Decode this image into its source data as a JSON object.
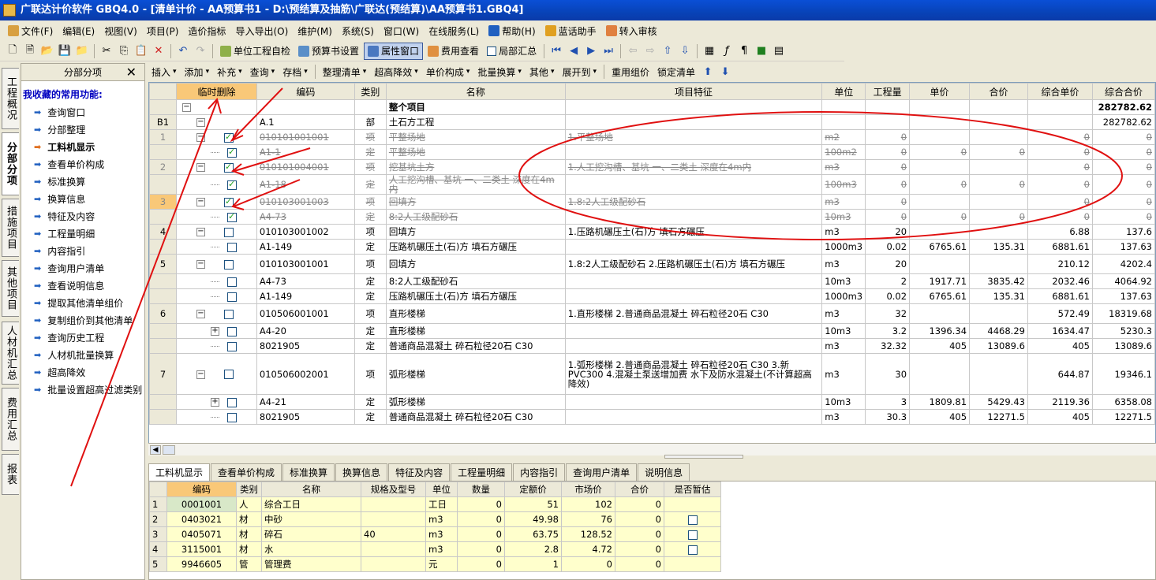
{
  "window": {
    "title": "广联达计价软件 GBQ4.0 - [清单计价 - AA预算书1 - D:\\预结算及抽筋\\广联达(预结算)\\AA预算书1.GBQ4]"
  },
  "menu": [
    "文件(F)",
    "编辑(E)",
    "视图(V)",
    "项目(P)",
    "造价指标",
    "导入导出(O)",
    "维护(M)",
    "系统(S)",
    "窗口(W)",
    "在线服务(L)",
    "帮助(H)",
    "蓝话助手",
    "转入审核"
  ],
  "toolbar1": {
    "self_check": "单位工程自检",
    "budget_settings": "预算书设置",
    "property_window": "属性窗口",
    "fee_view": "费用查看",
    "partial_summary": "局部汇总"
  },
  "toolbar2": [
    "插入",
    "添加",
    "补充",
    "查询",
    "存档",
    "整理清单",
    "超高降效",
    "单价构成",
    "批量换算",
    "其他",
    "展开到",
    "重用组价",
    "锁定清单"
  ],
  "left_tabs": [
    "工程概况",
    "分部分项",
    "措施项目",
    "其他项目",
    "人材机汇总",
    "费用汇总",
    "报表"
  ],
  "left_panel": {
    "title": "分部分项",
    "fav_title": "我收藏的常用功能:",
    "items": [
      "查询窗口",
      "分部整理",
      "工料机显示",
      "查看单价构成",
      "标准换算",
      "换算信息",
      "特征及内容",
      "工程量明细",
      "内容指引",
      "查询用户清单",
      "查看说明信息",
      "提取其他清单组价",
      "复制组价到其他清单",
      "查询历史工程",
      "人材机批量换算",
      "超高降效",
      "批量设置超高过滤类别"
    ]
  },
  "grid": {
    "headers": [
      "",
      "临时删除",
      "编码",
      "类别",
      "名称",
      "项目特征",
      "单位",
      "工程量",
      "单价",
      "合价",
      "综合单价",
      "综合合价"
    ],
    "rows": [
      {
        "rn": "",
        "pm": "-",
        "lvl": 0,
        "chk": "",
        "code": "",
        "type": "",
        "name": "整个项目",
        "feat": "",
        "unit": "",
        "qty": "",
        "price": "",
        "total": "",
        "cprice": "",
        "ctotal": "282782.62",
        "bold": true
      },
      {
        "rn": "B1",
        "pm": "-",
        "lvl": 1,
        "chk": "",
        "code": "A.1",
        "type": "部",
        "name": "土石方工程",
        "feat": "",
        "unit": "",
        "qty": "",
        "price": "",
        "total": "",
        "cprice": "",
        "ctotal": "282782.62"
      },
      {
        "rn": "1",
        "pm": "-",
        "lvl": 1,
        "chk": "on",
        "code": "010101001001",
        "type": "项",
        "name": "平整场地",
        "feat": "1.平整场地",
        "unit": "m2",
        "qty": "0",
        "price": "",
        "total": "",
        "cprice": "0",
        "ctotal": "0",
        "strike": true
      },
      {
        "rn": "",
        "pm": "",
        "lvl": 2,
        "chk": "on",
        "code": "A1-1",
        "type": "定",
        "name": "平整场地",
        "feat": "",
        "unit": "100m2",
        "qty": "0",
        "price": "0",
        "total": "0",
        "cprice": "0",
        "ctotal": "0",
        "strike": true
      },
      {
        "rn": "2",
        "pm": "-",
        "lvl": 1,
        "chk": "on",
        "code": "010101004001",
        "type": "项",
        "name": "挖基坑土方",
        "feat": "1.人工挖沟槽、基坑 一、二类土 深度在4m内",
        "unit": "m3",
        "qty": "0",
        "price": "",
        "total": "",
        "cprice": "0",
        "ctotal": "0",
        "strike": true
      },
      {
        "rn": "",
        "pm": "",
        "lvl": 2,
        "chk": "on",
        "code": "A1-18",
        "type": "定",
        "name": "人工挖沟槽、基坑 一、二类土 深度在4m内",
        "feat": "",
        "unit": "100m3",
        "qty": "0",
        "price": "0",
        "total": "0",
        "cprice": "0",
        "ctotal": "0",
        "strike": true,
        "tall": true
      },
      {
        "rn": "3",
        "pm": "-",
        "lvl": 1,
        "chk": "on",
        "code": "010103001003",
        "type": "项",
        "name": "回填方",
        "feat": "1.8:2人工级配砂石",
        "unit": "m3",
        "qty": "0",
        "price": "",
        "total": "",
        "cprice": "0",
        "ctotal": "0",
        "strike": true,
        "hl": true
      },
      {
        "rn": "",
        "pm": "",
        "lvl": 2,
        "chk": "on",
        "code": "A4-73",
        "type": "定",
        "name": "8:2人工级配砂石",
        "feat": "",
        "unit": "10m3",
        "qty": "0",
        "price": "0",
        "total": "0",
        "cprice": "0",
        "ctotal": "0",
        "strike": true
      },
      {
        "rn": "4",
        "pm": "-",
        "lvl": 1,
        "chk": "off",
        "code": "010103001002",
        "type": "项",
        "name": "回填方",
        "feat": "1.压路机碾压土(石)方 填石方碾压",
        "unit": "m3",
        "qty": "20",
        "price": "",
        "total": "",
        "cprice": "6.88",
        "ctotal": "137.6"
      },
      {
        "rn": "",
        "pm": "",
        "lvl": 2,
        "chk": "off",
        "code": "A1-149",
        "type": "定",
        "name": "压路机碾压土(石)方 填石方碾压",
        "feat": "",
        "unit": "1000m3",
        "qty": "0.02",
        "price": "6765.61",
        "total": "135.31",
        "cprice": "6881.61",
        "ctotal": "137.63"
      },
      {
        "rn": "5",
        "pm": "-",
        "lvl": 1,
        "chk": "off",
        "code": "010103001001",
        "type": "项",
        "name": "回填方",
        "feat": "1.8:2人工级配砂石\n2.压路机碾压土(石)方 填石方碾压",
        "unit": "m3",
        "qty": "20",
        "price": "",
        "total": "",
        "cprice": "210.12",
        "ctotal": "4202.4",
        "tall": true
      },
      {
        "rn": "",
        "pm": "",
        "lvl": 2,
        "chk": "off",
        "code": "A4-73",
        "type": "定",
        "name": "8:2人工级配砂石",
        "feat": "",
        "unit": "10m3",
        "qty": "2",
        "price": "1917.71",
        "total": "3835.42",
        "cprice": "2032.46",
        "ctotal": "4064.92"
      },
      {
        "rn": "",
        "pm": "",
        "lvl": 2,
        "chk": "off",
        "code": "A1-149",
        "type": "定",
        "name": "压路机碾压土(石)方 填石方碾压",
        "feat": "",
        "unit": "1000m3",
        "qty": "0.02",
        "price": "6765.61",
        "total": "135.31",
        "cprice": "6881.61",
        "ctotal": "137.63"
      },
      {
        "rn": "6",
        "pm": "-",
        "lvl": 1,
        "chk": "off",
        "code": "010506001001",
        "type": "项",
        "name": "直形楼梯",
        "feat": "1.直形楼梯\n2.普通商品混凝土 碎石粒径20石 C30",
        "unit": "m3",
        "qty": "32",
        "price": "",
        "total": "",
        "cprice": "572.49",
        "ctotal": "18319.68",
        "tall": true
      },
      {
        "rn": "",
        "pm": "+",
        "lvl": 2,
        "chk": "off",
        "code": "A4-20",
        "type": "定",
        "name": "直形楼梯",
        "feat": "",
        "unit": "10m3",
        "qty": "3.2",
        "price": "1396.34",
        "total": "4468.29",
        "cprice": "1634.47",
        "ctotal": "5230.3"
      },
      {
        "rn": "",
        "pm": "",
        "lvl": 2,
        "chk": "off",
        "code": "8021905",
        "type": "定",
        "name": "普通商品混凝土 碎石粒径20石 C30",
        "feat": "",
        "unit": "m3",
        "qty": "32.32",
        "price": "405",
        "total": "13089.6",
        "cprice": "405",
        "ctotal": "13089.6"
      },
      {
        "rn": "7",
        "pm": "-",
        "lvl": 1,
        "chk": "off",
        "code": "010506002001",
        "type": "项",
        "name": "弧形楼梯",
        "feat": "1.弧形楼梯\n2.普通商品混凝土 碎石粒径20石 C30\n3.新PVC300\n4.混凝土泵送增加费 水下及防水混凝土(不计算超高降效)",
        "unit": "m3",
        "qty": "30",
        "price": "",
        "total": "",
        "cprice": "644.87",
        "ctotal": "19346.1",
        "xtall": true
      },
      {
        "rn": "",
        "pm": "+",
        "lvl": 2,
        "chk": "off",
        "code": "A4-21",
        "type": "定",
        "name": "弧形楼梯",
        "feat": "",
        "unit": "10m3",
        "qty": "3",
        "price": "1809.81",
        "total": "5429.43",
        "cprice": "2119.36",
        "ctotal": "6358.08"
      },
      {
        "rn": "",
        "pm": "",
        "lvl": 2,
        "chk": "off",
        "code": "8021905",
        "type": "定",
        "name": "普通商品混凝土 碎石粒径20石 C30",
        "feat": "",
        "unit": "m3",
        "qty": "30.3",
        "price": "405",
        "total": "12271.5",
        "cprice": "405",
        "ctotal": "12271.5"
      }
    ]
  },
  "bottom_tabs": [
    "工料机显示",
    "查看单价构成",
    "标准换算",
    "换算信息",
    "特征及内容",
    "工程量明细",
    "内容指引",
    "查询用户清单",
    "说明信息"
  ],
  "bottom_grid": {
    "headers": [
      "",
      "编码",
      "类别",
      "名称",
      "规格及型号",
      "单位",
      "数量",
      "定额价",
      "市场价",
      "合价",
      "是否暂估"
    ],
    "rows": [
      {
        "rn": "1",
        "code": "0001001",
        "type": "人",
        "name": "综合工日",
        "spec": "",
        "unit": "工日",
        "qty": "0",
        "price": "51",
        "mprice": "102",
        "total": "0",
        "est": false
      },
      {
        "rn": "2",
        "code": "0403021",
        "type": "材",
        "name": "中砂",
        "spec": "",
        "unit": "m3",
        "qty": "0",
        "price": "49.98",
        "mprice": "76",
        "total": "0",
        "est": true
      },
      {
        "rn": "3",
        "code": "0405071",
        "type": "材",
        "name": "碎石",
        "spec": "40",
        "unit": "m3",
        "qty": "0",
        "price": "63.75",
        "mprice": "128.52",
        "total": "0",
        "est": true
      },
      {
        "rn": "4",
        "code": "3115001",
        "type": "材",
        "name": "水",
        "spec": "",
        "unit": "m3",
        "qty": "0",
        "price": "2.8",
        "mprice": "4.72",
        "total": "0",
        "est": true
      },
      {
        "rn": "5",
        "code": "9946605",
        "type": "管",
        "name": "管理费",
        "spec": "",
        "unit": "元",
        "qty": "0",
        "price": "1",
        "mprice": "0",
        "total": "0",
        "est": false
      }
    ]
  }
}
